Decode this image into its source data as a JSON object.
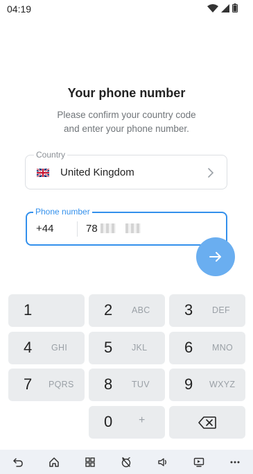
{
  "status_bar": {
    "time": "04:19",
    "icons": [
      "wifi-icon",
      "cellular-signal-icon",
      "battery-icon"
    ]
  },
  "page": {
    "title": "Your phone number",
    "subtitle_line1": "Please confirm your country code",
    "subtitle_line2": "and enter your phone number."
  },
  "country": {
    "label": "Country",
    "flag_icon": "uk-flag-icon",
    "name": "United Kingdom"
  },
  "phone": {
    "label": "Phone number",
    "code": "+44",
    "number_visible": "78"
  },
  "keypad": {
    "keys": [
      {
        "digit": "1",
        "letters": ""
      },
      {
        "digit": "2",
        "letters": "ABC"
      },
      {
        "digit": "3",
        "letters": "DEF"
      },
      {
        "digit": "4",
        "letters": "GHI"
      },
      {
        "digit": "5",
        "letters": "JKL"
      },
      {
        "digit": "6",
        "letters": "MNO"
      },
      {
        "digit": "7",
        "letters": "PQRS"
      },
      {
        "digit": "8",
        "letters": "TUV"
      },
      {
        "digit": "9",
        "letters": "WXYZ"
      },
      {
        "digit": "0",
        "letters": "+"
      }
    ]
  },
  "nav_bar": {
    "items": [
      "back-icon",
      "home-icon",
      "apps-grid-icon",
      "do-not-disturb-icon",
      "volume-icon",
      "screen-cast-icon",
      "more-icon"
    ]
  },
  "colors": {
    "accent": "#3390ec",
    "next_button": "#6aaef0",
    "key_background": "#eaecee",
    "nav_background": "#eef1f6"
  }
}
